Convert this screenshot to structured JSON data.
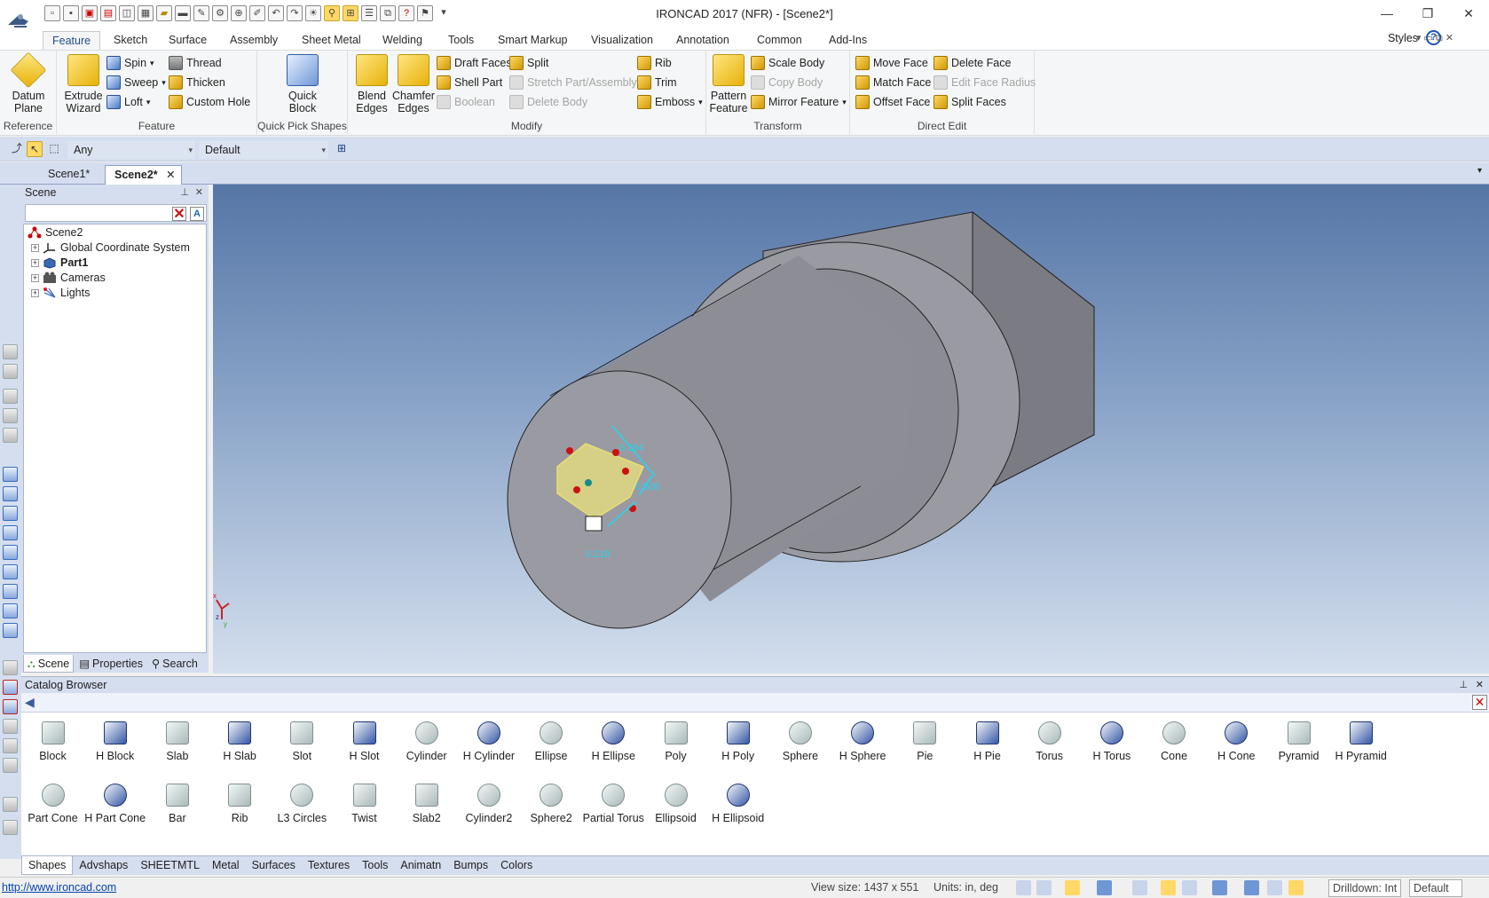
{
  "window": {
    "title": "IRONCAD 2017 (NFR) - [Scene2*]",
    "minimize": "—",
    "restore": "❐",
    "close": "✕"
  },
  "ribbon_tabs": [
    "Feature",
    "Sketch",
    "Surface",
    "Assembly",
    "Sheet Metal",
    "Welding",
    "Tools",
    "Smart Markup",
    "Visualization",
    "Annotation",
    "Common",
    "Add-Ins"
  ],
  "ribbon_right": {
    "styles": "Styles",
    "help": "?"
  },
  "ribbon": {
    "reference": {
      "label": "Reference",
      "datum": "Datum\nPlane"
    },
    "feature": {
      "label": "Feature",
      "extrude": "Extrude\nWizard",
      "spin": "Spin",
      "sweep": "Sweep",
      "loft": "Loft",
      "thread": "Thread",
      "thicken": "Thicken",
      "custom_hole": "Custom Hole"
    },
    "quick_pick": {
      "label": "Quick Pick Shapes",
      "quick_block": "Quick\nBlock"
    },
    "modify": {
      "label": "Modify",
      "blend": "Blend\nEdges",
      "chamfer": "Chamfer\nEdges",
      "draft": "Draft Faces",
      "shell": "Shell Part",
      "boolean": "Boolean",
      "split": "Split",
      "stretch": "Stretch Part/Assembly",
      "delete_body": "Delete Body",
      "rib": "Rib",
      "trim": "Trim",
      "emboss": "Emboss"
    },
    "transform": {
      "label": "Transform",
      "pattern": "Pattern\nFeature",
      "scale": "Scale Body",
      "copy": "Copy Body",
      "mirror": "Mirror Feature"
    },
    "direct_edit": {
      "label": "Direct Edit",
      "move_face": "Move Face",
      "match_face": "Match Face",
      "offset_face": "Offset Face",
      "delete_face": "Delete Face",
      "edit_radius": "Edit Face Radius",
      "split_faces": "Split Faces"
    }
  },
  "selection_filter": {
    "value": "Any",
    "style": "Default"
  },
  "doc_tabs": [
    "Scene1*",
    "Scene2*"
  ],
  "scene_panel": {
    "title": "Scene",
    "tree": [
      {
        "label": "Scene2",
        "bold": false
      },
      {
        "label": "Global Coordinate System",
        "bold": false
      },
      {
        "label": "Part1",
        "bold": true
      },
      {
        "label": "Cameras",
        "bold": false
      },
      {
        "label": "Lights",
        "bold": false
      }
    ],
    "tabs": [
      "Scene",
      "Properties",
      "Search"
    ]
  },
  "viewport": {
    "dimensions": [
      "0.394",
      "0.306",
      "0.218"
    ],
    "axis_labels": [
      "x",
      "y",
      "z"
    ]
  },
  "catalog": {
    "title": "Catalog Browser",
    "shapes_row1": [
      "Block",
      "H Block",
      "Slab",
      "H Slab",
      "Slot",
      "H Slot",
      "Cylinder",
      "H Cylinder",
      "Ellipse",
      "H Ellipse",
      "Poly",
      "H Poly",
      "Sphere",
      "H Sphere",
      "Pie",
      "H Pie",
      "Torus",
      "H Torus",
      "Cone",
      "H Cone",
      "Pyramid",
      "H Pyramid"
    ],
    "shapes_row2": [
      "Part Cone",
      "H Part Cone",
      "Bar",
      "Rib",
      "L3 Circles",
      "Twist",
      "Slab2",
      "Cylinder2",
      "Sphere2",
      "Partial Torus",
      "Ellipsoid",
      "H Ellipsoid"
    ],
    "tabs": [
      "Shapes",
      "Advshaps",
      "SHEETMTL",
      "Metal",
      "Surfaces",
      "Textures",
      "Tools",
      "Animatn",
      "Bumps",
      "Colors"
    ]
  },
  "status": {
    "link": "http://www.ironcad.com",
    "view_size": "View size: 1437 x  551",
    "units": "Units: in, deg",
    "drilldown": "Drilldown: Int",
    "default": "Default"
  }
}
